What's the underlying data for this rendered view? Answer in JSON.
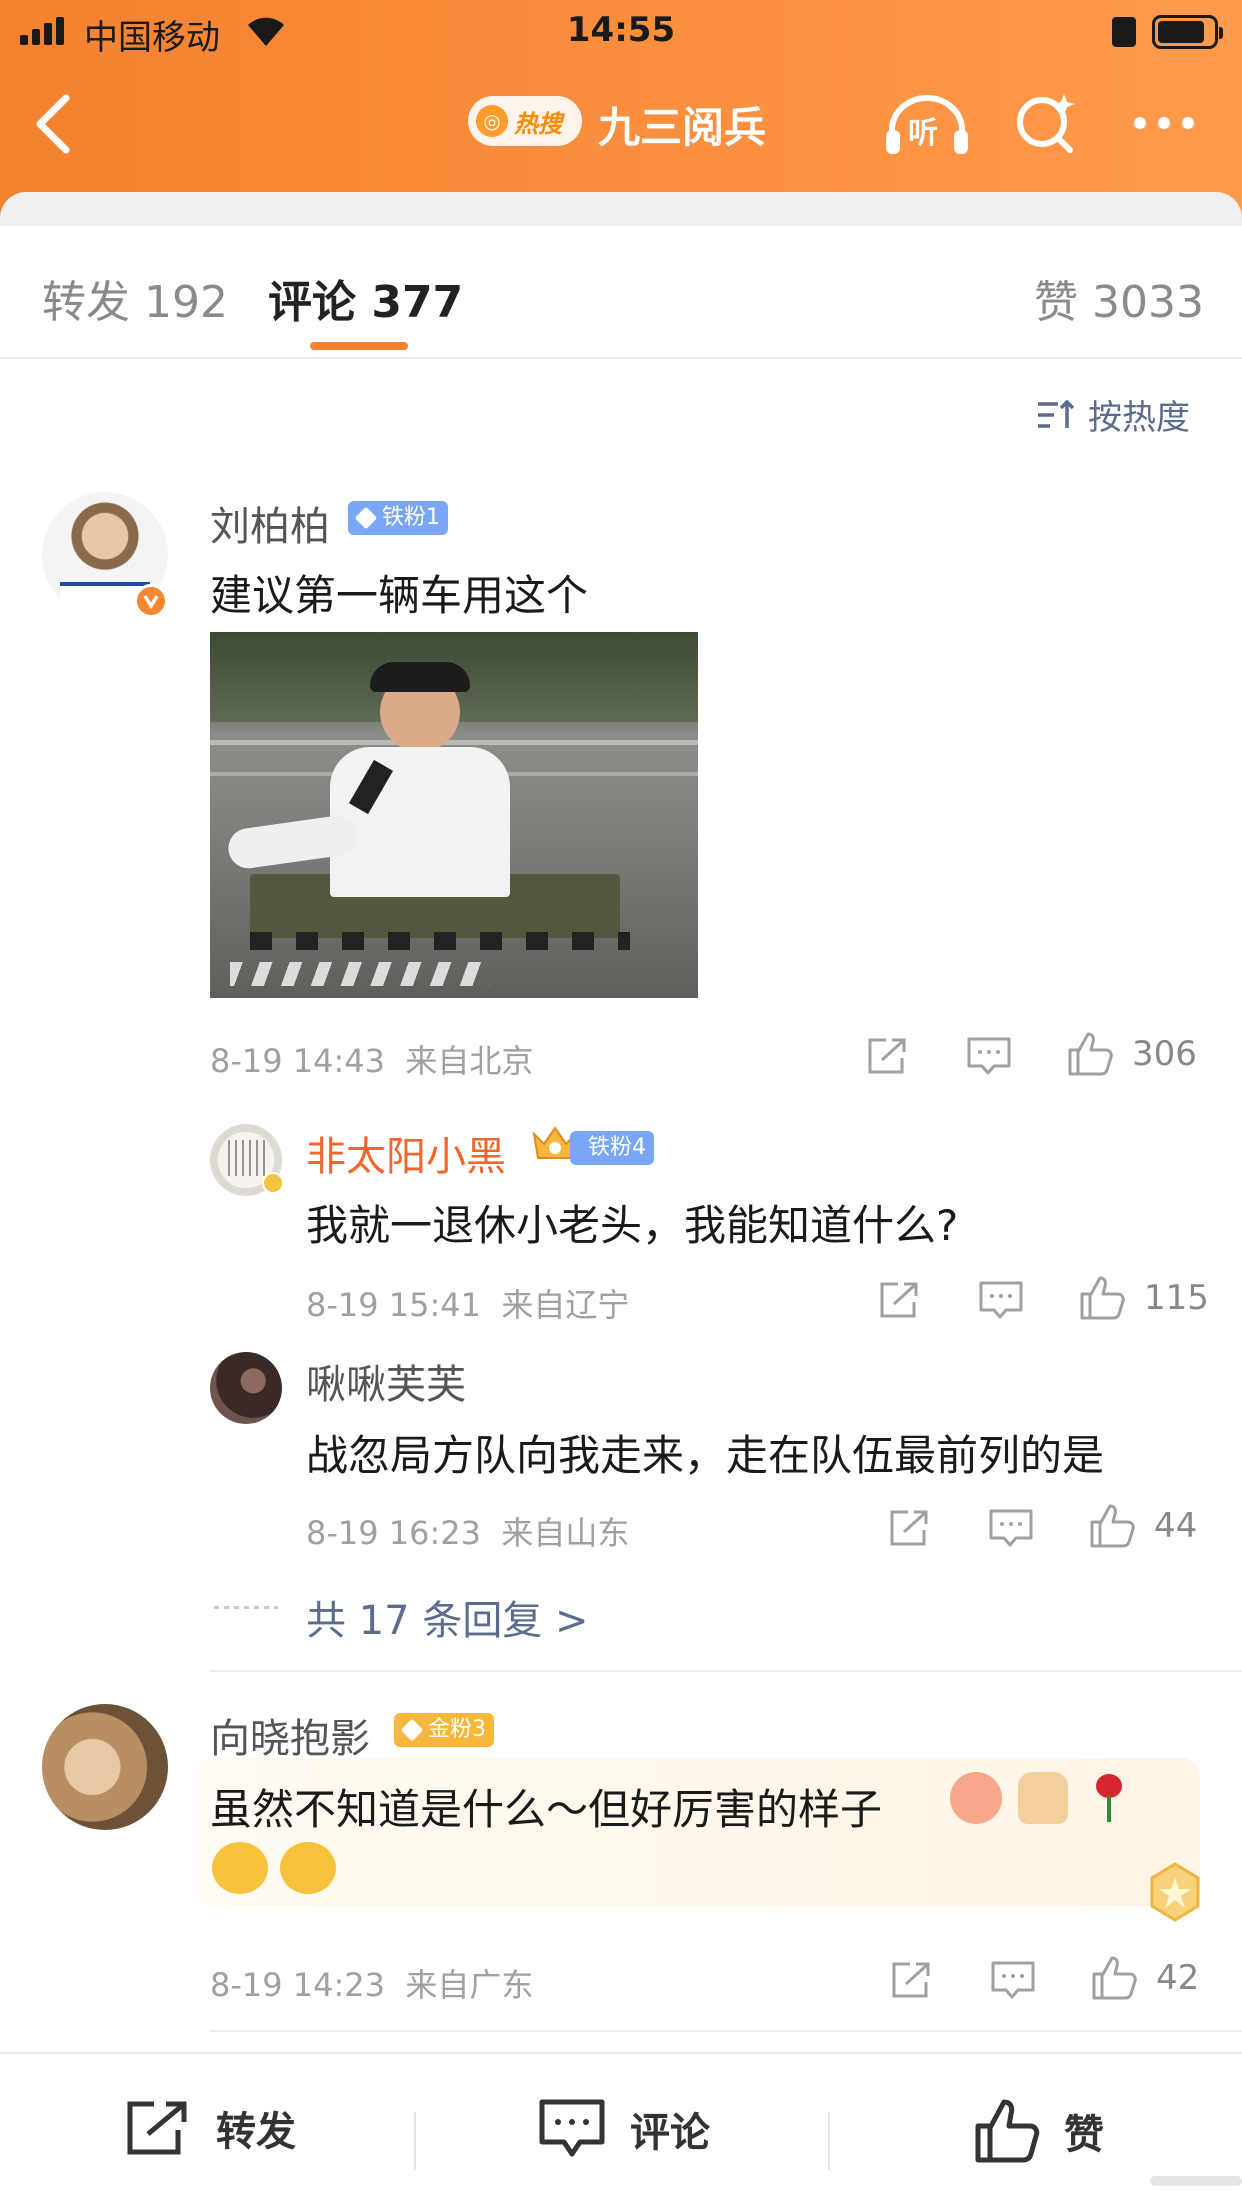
{
  "status_bar": {
    "carrier": "中国移动",
    "time": "14:55"
  },
  "nav": {
    "hot_label": "热搜",
    "title": "九三阅兵",
    "listen_label": "听"
  },
  "tabs": [
    {
      "label": "转发",
      "count": "192"
    },
    {
      "label": "评论",
      "count": "377"
    },
    {
      "label": "赞",
      "count": "3033"
    }
  ],
  "sort_label": "按热度",
  "comments": [
    {
      "user": "刘柏柏",
      "badge": "铁粉1",
      "text": "建议第一辆车用这个",
      "time": "8-19 14:43",
      "location": "来自北京",
      "likes": "306",
      "replies": [
        {
          "user": "非太阳小黑",
          "badge": "铁粉4",
          "text": "我就一退休小老头，我能知道什么?",
          "time": "8-19 15:41",
          "location": "来自辽宁",
          "likes": "115"
        },
        {
          "user": "啾啾芙芙",
          "text": "战忽局方队向我走来，走在队伍最前列的是",
          "time": "8-19 16:23",
          "location": "来自山东",
          "likes": "44"
        }
      ],
      "more_replies": "共 17 条回复 >"
    },
    {
      "user": "向晓抱影",
      "badge": "金粉3",
      "text": "虽然不知道是什么～但好厉害的样子",
      "time": "8-19 14:23",
      "location": "来自广东",
      "likes": "42"
    }
  ],
  "bottom_bar": {
    "repost": "转发",
    "comment": "评论",
    "like": "赞"
  },
  "colors": {
    "header_orange": "#f4822f",
    "accent_orange": "#f4822f",
    "link_blue": "#5b6c8f",
    "iron_badge": "#7aa7f5",
    "gold_badge": "#f6b73c"
  }
}
